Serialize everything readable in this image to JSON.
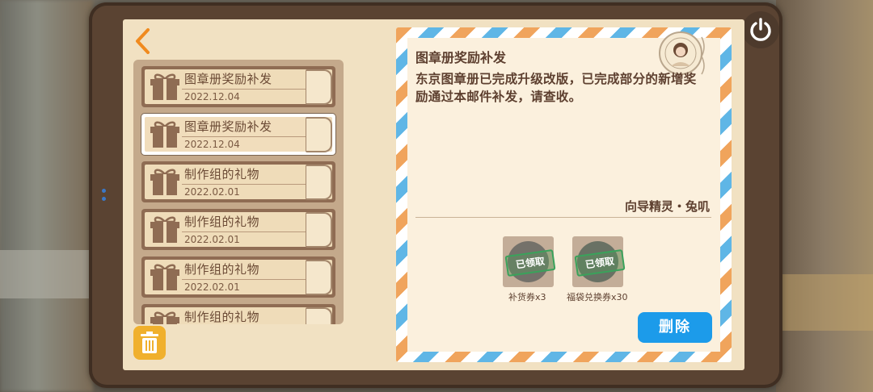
{
  "mail_list": [
    {
      "title": "图章册奖励补发",
      "date": "2022.12.04",
      "selected": false
    },
    {
      "title": "图章册奖励补发",
      "date": "2022.12.04",
      "selected": true
    },
    {
      "title": "制作组的礼物",
      "date": "2022.02.01",
      "selected": false
    },
    {
      "title": "制作组的礼物",
      "date": "2022.02.01",
      "selected": false
    },
    {
      "title": "制作组的礼物",
      "date": "2022.02.01",
      "selected": false
    },
    {
      "title": "制作组的礼物",
      "date": "",
      "selected": false
    }
  ],
  "letter": {
    "title": "图章册奖励补发",
    "body": "东京图章册已完成升级改版，已完成部分的新增奖励通过本邮件补发，请查收。",
    "signature": "向导精灵・兔叽"
  },
  "rewards": [
    {
      "status": "已领取",
      "label": "补货券x3",
      "icon": "coupon-icon"
    },
    {
      "status": "已领取",
      "label": "福袋兑换券x30",
      "icon": "lucky-bag-ticket-icon"
    }
  ],
  "buttons": {
    "delete_label": "删除"
  },
  "colors": {
    "accent_blue": "#1c9bea",
    "trash_yellow": "#f0b02d",
    "paper": "#fbf0dd",
    "claimed_green": "#3aa25b"
  }
}
